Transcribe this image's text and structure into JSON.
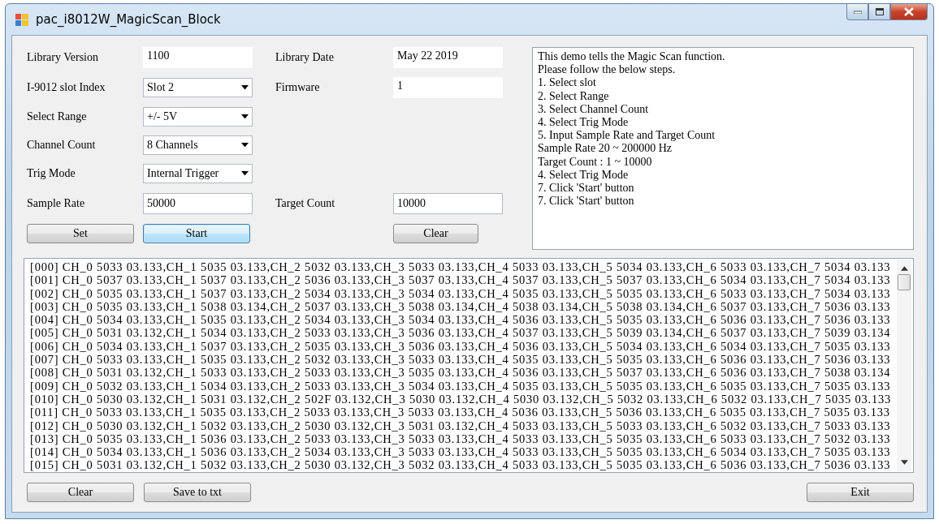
{
  "window": {
    "title": "pac_i8012W_MagicScan_Block"
  },
  "form_rows": [
    {
      "left": {
        "label": "Library Version",
        "kind": "readonly",
        "value": "1100"
      },
      "right": {
        "label": "Library Date",
        "kind": "readonly",
        "value": "May 22 2019"
      }
    },
    {
      "left": {
        "label": "I-9012 slot Index",
        "kind": "dropdown",
        "value": "Slot 2"
      },
      "right": {
        "label": "Firmware",
        "kind": "readonly",
        "value": "1"
      }
    },
    {
      "left": {
        "label": "Select Range",
        "kind": "dropdown",
        "value": "+/- 5V"
      }
    },
    {
      "left": {
        "label": "Channel Count",
        "kind": "dropdown",
        "value": "8 Channels"
      }
    },
    {
      "left": {
        "label": "Trig Mode",
        "kind": "dropdown",
        "value": "Internal Trigger"
      }
    },
    {
      "left": {
        "label": "Sample Rate",
        "kind": "input",
        "value": "50000"
      },
      "right": {
        "label": "Target Count",
        "kind": "input",
        "value": "10000"
      }
    }
  ],
  "left_buttons": [
    {
      "label": "Set",
      "focused": false
    },
    {
      "label": "Start",
      "focused": true
    }
  ],
  "right_buttons": [
    {
      "label": "Clear",
      "focused": false
    }
  ],
  "info_lines": [
    "This demo tells the Magic Scan function.",
    "Please follow the below steps.",
    "1. Select slot",
    "2. Select Range",
    "3. Select Channel Count",
    "4. Select Trig Mode",
    "5. Input Sample Rate and Target Count",
    "Sample Rate 20 ~ 200000 Hz",
    "Target Count : 1 ~ 10000",
    "4. Select Trig Mode",
    "7. Click 'Start' button",
    "7. Click 'Start' button"
  ],
  "log_lines": [
    "[000] CH_0 5033 03.133,CH_1 5035 03.133,CH_2 5032 03.133,CH_3 5033 03.133,CH_4 5033 03.133,CH_5 5034 03.133,CH_6 5033 03.133,CH_7 5034 03.133",
    "[001] CH_0 5037 03.133,CH_1 5037 03.133,CH_2 5036 03.133,CH_3 5037 03.133,CH_4 5037 03.133,CH_5 5037 03.133,CH_6 5034 03.133,CH_7 5034 03.133",
    "[002] CH_0 5035 03.133,CH_1 5037 03.133,CH_2 5034 03.133,CH_3 5034 03.133,CH_4 5035 03.133,CH_5 5035 03.133,CH_6 5033 03.133,CH_7 5034 03.133",
    "[003] CH_0 5035 03.133,CH_1 5038 03.134,CH_2 5037 03.133,CH_3 5038 03.134,CH_4 5038 03.134,CH_5 5038 03.134,CH_6 5037 03.133,CH_7 5036 03.133",
    "[004] CH_0 5034 03.133,CH_1 5035 03.133,CH_2 5034 03.133,CH_3 5034 03.133,CH_4 5036 03.133,CH_5 5035 03.133,CH_6 5036 03.133,CH_7 5036 03.133",
    "[005] CH_0 5031 03.132,CH_1 5034 03.133,CH_2 5033 03.133,CH_3 5036 03.133,CH_4 5037 03.133,CH_5 5039 03.134,CH_6 5037 03.133,CH_7 5039 03.134",
    "[006] CH_0 5034 03.133,CH_1 5037 03.133,CH_2 5035 03.133,CH_3 5036 03.133,CH_4 5036 03.133,CH_5 5034 03.133,CH_6 5034 03.133,CH_7 5035 03.133",
    "[007] CH_0 5033 03.133,CH_1 5035 03.133,CH_2 5032 03.133,CH_3 5033 03.133,CH_4 5035 03.133,CH_5 5035 03.133,CH_6 5036 03.133,CH_7 5036 03.133",
    "[008] CH_0 5031 03.132,CH_1 5033 03.133,CH_2 5033 03.133,CH_3 5035 03.133,CH_4 5036 03.133,CH_5 5037 03.133,CH_6 5036 03.133,CH_7 5038 03.134",
    "[009] CH_0 5032 03.133,CH_1 5034 03.133,CH_2 5033 03.133,CH_3 5034 03.133,CH_4 5035 03.133,CH_5 5035 03.133,CH_6 5035 03.133,CH_7 5035 03.133",
    "[010] CH_0 5030 03.132,CH_1 5031 03.132,CH_2 502F 03.132,CH_3 5030 03.132,CH_4 5030 03.132,CH_5 5032 03.133,CH_6 5032 03.133,CH_7 5035 03.133",
    "[011] CH_0 5033 03.133,CH_1 5035 03.133,CH_2 5033 03.133,CH_3 5033 03.133,CH_4 5036 03.133,CH_5 5036 03.133,CH_6 5035 03.133,CH_7 5035 03.133",
    "[012] CH_0 5030 03.132,CH_1 5032 03.133,CH_2 5030 03.132,CH_3 5031 03.132,CH_4 5033 03.133,CH_5 5033 03.133,CH_6 5032 03.133,CH_7 5033 03.133",
    "[013] CH_0 5035 03.133,CH_1 5036 03.133,CH_2 5033 03.133,CH_3 5033 03.133,CH_4 5033 03.133,CH_5 5035 03.133,CH_6 5033 03.133,CH_7 5032 03.133",
    "[014] CH_0 5034 03.133,CH_1 5036 03.133,CH_2 5034 03.133,CH_3 5033 03.133,CH_4 5033 03.133,CH_5 5035 03.133,CH_6 5034 03.133,CH_7 5035 03.133",
    "[015] CH_0 5031 03.132,CH_1 5032 03.133,CH_2 5030 03.132,CH_3 5032 03.133,CH_4 5033 03.133,CH_5 5035 03.133,CH_6 5036 03.133,CH_7 5036 03.133"
  ],
  "bottom_left_buttons": [
    {
      "label": "Clear",
      "focused": false
    },
    {
      "label": "Save to txt",
      "focused": false
    }
  ],
  "bottom_right_buttons": [
    {
      "label": "Exit",
      "focused": false
    }
  ]
}
